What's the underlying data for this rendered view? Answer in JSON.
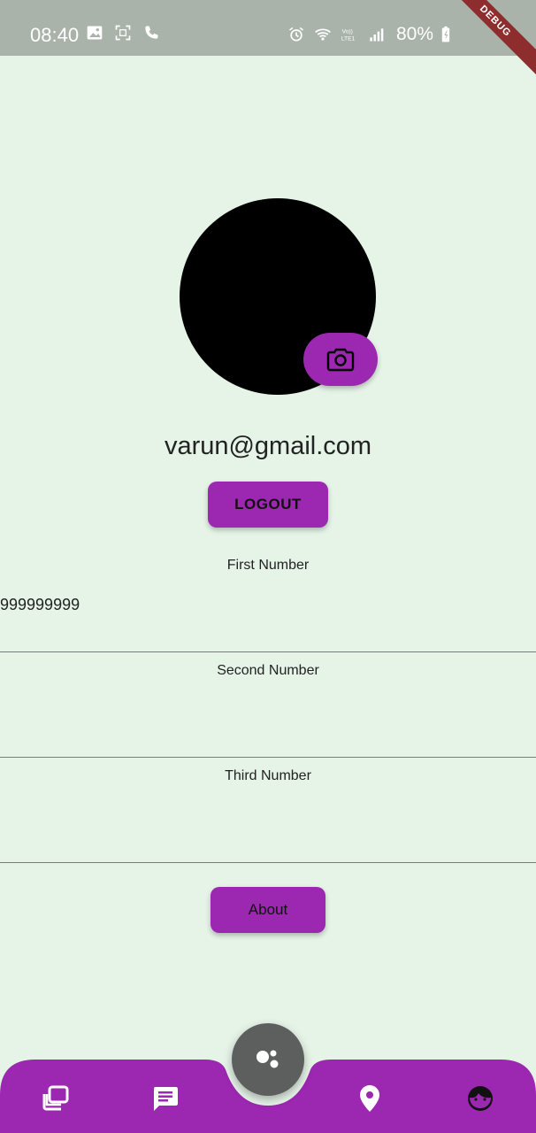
{
  "status_bar": {
    "time": "08:40",
    "battery": "80%",
    "left_icons": [
      "image-icon",
      "screenshot-icon",
      "phone-icon"
    ],
    "right_icons": [
      "alarm-icon",
      "wifi-icon",
      "volte-icon",
      "signal-icon",
      "battery-charging-icon"
    ],
    "volte_text": "Vo))\nLTE1"
  },
  "debug_banner": "DEBUG",
  "profile": {
    "email": "varun@gmail.com",
    "logout_label": "LOGOUT"
  },
  "fields": [
    {
      "label": "First Number",
      "value": "999999999"
    },
    {
      "label": "Second Number",
      "value": ""
    },
    {
      "label": "Third Number",
      "value": ""
    }
  ],
  "about_label": "About",
  "bottom_nav": {
    "items": [
      "gallery-icon",
      "chat-icon",
      "location-pin-icon",
      "profile-face-icon"
    ],
    "fab_icon": "assistant-dots-icon"
  },
  "colors": {
    "background": "#e6f4e8",
    "accent": "#9c27b0",
    "status_bar": "#a9b3aa",
    "fab": "#5d5f5e"
  }
}
